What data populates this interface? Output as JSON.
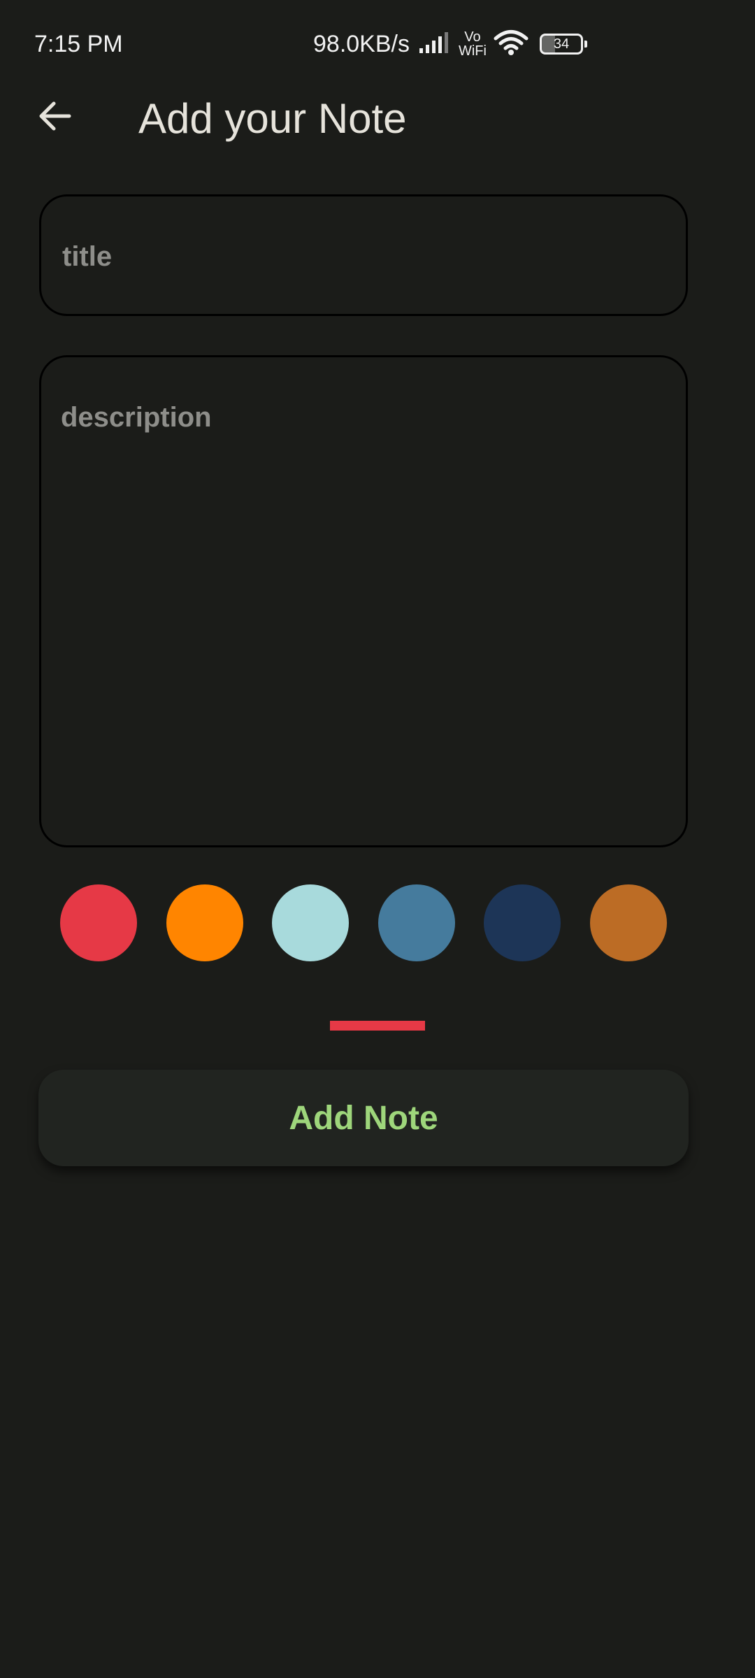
{
  "status_bar": {
    "time": "7:15 PM",
    "net_speed": "98.0KB/s",
    "vowifi_top": "Vo",
    "vowifi_bottom": "WiFi",
    "battery_level": "34",
    "battery_fraction": 0.34,
    "icons": [
      "signal-icon",
      "wifi-icon",
      "battery-icon"
    ]
  },
  "app_bar": {
    "back_icon": "arrow-left-icon",
    "title": "Add your Note"
  },
  "form": {
    "title_field": {
      "value": "",
      "placeholder": "title"
    },
    "description_field": {
      "value": "",
      "placeholder": "description"
    }
  },
  "color_picker": {
    "colors": [
      "#e63946",
      "#ff8500",
      "#a8dadc",
      "#457b9d",
      "#1d3557",
      "#bc6c25"
    ],
    "selected_color": "#e63946",
    "selected_index": 0
  },
  "add_button": {
    "label": "Add Note",
    "text_color": "#9ed67b"
  },
  "theme": {
    "background": "#1b1c19",
    "button_background": "#212420",
    "field_border": "#000000",
    "placeholder_color": "#8e8e8a",
    "title_color": "#e6e3db"
  }
}
